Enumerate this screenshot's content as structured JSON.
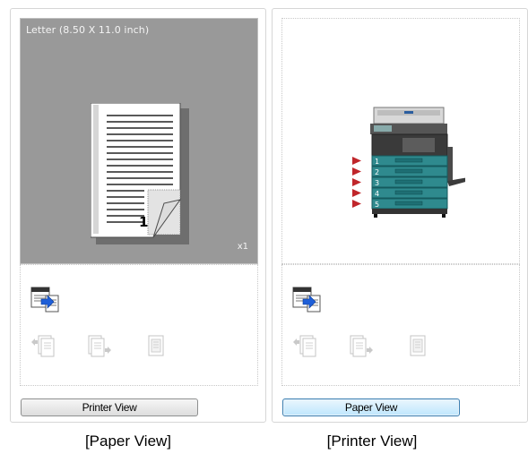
{
  "left_panel": {
    "paper_size_label": "Letter  (8.50 X 11.0 inch)",
    "page_number": "1",
    "copies": "x1",
    "button_label": "Printer View",
    "caption": "[Paper View]"
  },
  "right_panel": {
    "tray_numbers": [
      "1",
      "2",
      "3",
      "4",
      "5"
    ],
    "button_label": "Paper View",
    "caption": "[Printer View]"
  },
  "icons": {
    "function_main": "layout-settings-icon",
    "function_1": "binding-left-icon",
    "function_2": "binding-right-icon",
    "function_3": "booklet-icon",
    "printer": "printer-icon"
  },
  "colors": {
    "preview_background": "#999999",
    "tray_teal": "#2f8a8e",
    "tray_arrow": "#c0262b",
    "button_focus_border": "#3c7fb1"
  }
}
